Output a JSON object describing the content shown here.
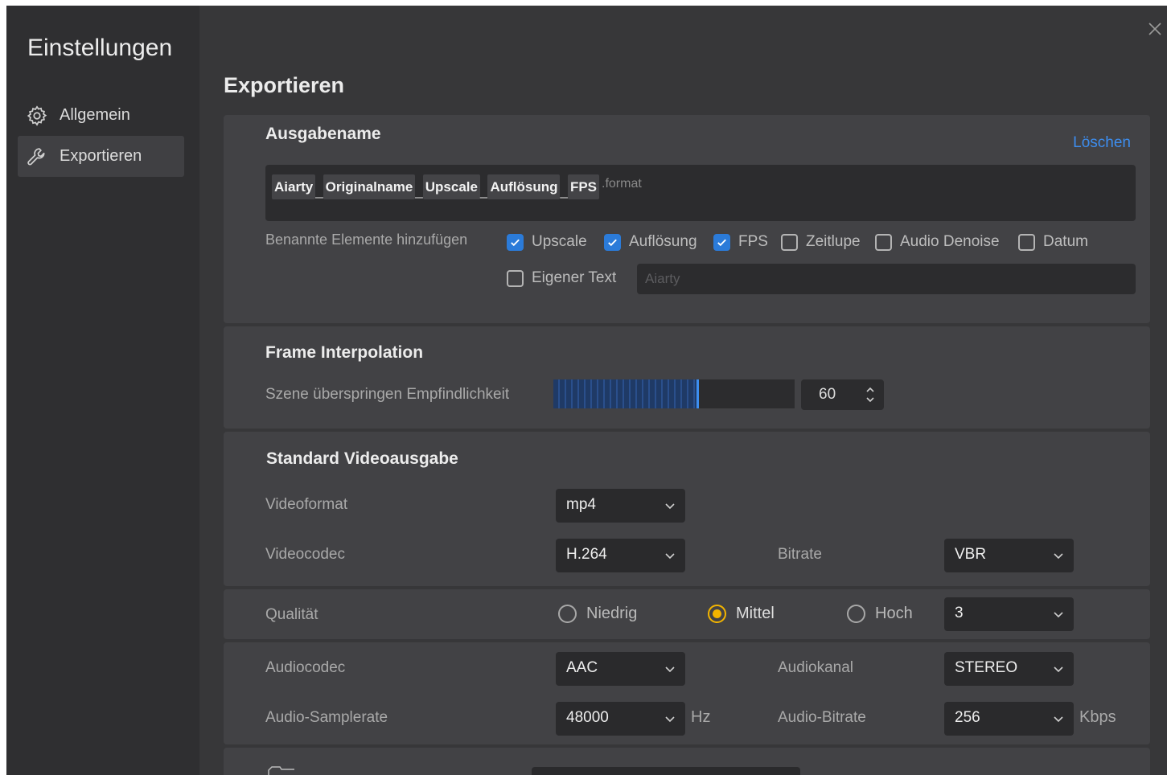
{
  "app_title": "Einstellungen",
  "nav": {
    "general": {
      "label": "Allgemein",
      "icon": "gear-icon"
    },
    "export": {
      "label": "Exportieren",
      "icon": "wrench-icon"
    }
  },
  "page_title": "Exportieren",
  "output_name": {
    "title": "Ausgabename",
    "delete_link": "Löschen",
    "chips": [
      "Aiarty",
      "Originalname",
      "Upscale",
      "Auflösung",
      "FPS"
    ],
    "separator": "_",
    "format_suffix": ".format",
    "add_label": "Benannte Elemente hinzufügen",
    "checkboxes": {
      "upscale": {
        "label": "Upscale",
        "checked": true
      },
      "resolution": {
        "label": "Auflösung",
        "checked": true
      },
      "fps": {
        "label": "FPS",
        "checked": true
      },
      "slowmo": {
        "label": "Zeitlupe",
        "checked": false
      },
      "audio_denoise": {
        "label": "Audio Denoise",
        "checked": false
      },
      "date": {
        "label": "Datum",
        "checked": false
      },
      "custom_text": {
        "label": "Eigener Text",
        "checked": false
      }
    },
    "custom_text_placeholder": "Aiarty"
  },
  "frame_interpolation": {
    "title": "Frame Interpolation",
    "scene_skip_label": "Szene überspringen Empfindlichkeit",
    "sensitivity_value": "60",
    "sensitivity_fraction": 0.6
  },
  "video_output": {
    "title": "Standard Videoausgabe",
    "format_label": "Videoformat",
    "format_value": "mp4",
    "codec_label": "Videocodec",
    "codec_value": "H.264",
    "bitrate_label": "Bitrate",
    "bitrate_value": "VBR",
    "quality_label": "Qualität",
    "quality_options": {
      "low": "Niedrig",
      "mid": "Mittel",
      "high": "Hoch"
    },
    "quality_selected": "mid",
    "quality_value": "3",
    "audio_codec_label": "Audiocodec",
    "audio_codec_value": "AAC",
    "audio_channel_label": "Audiokanal",
    "audio_channel_value": "STEREO",
    "sample_rate_label": "Audio-Samplerate",
    "sample_rate_value": "48000",
    "sample_rate_unit": "Hz",
    "audio_bitrate_label": "Audio-Bitrate",
    "audio_bitrate_value": "256",
    "audio_bitrate_unit": "Kbps"
  },
  "colors": {
    "accent": "#3d8ef0",
    "radio_selected": "#f2b400",
    "checkbox_on": "#2b7bd9"
  }
}
